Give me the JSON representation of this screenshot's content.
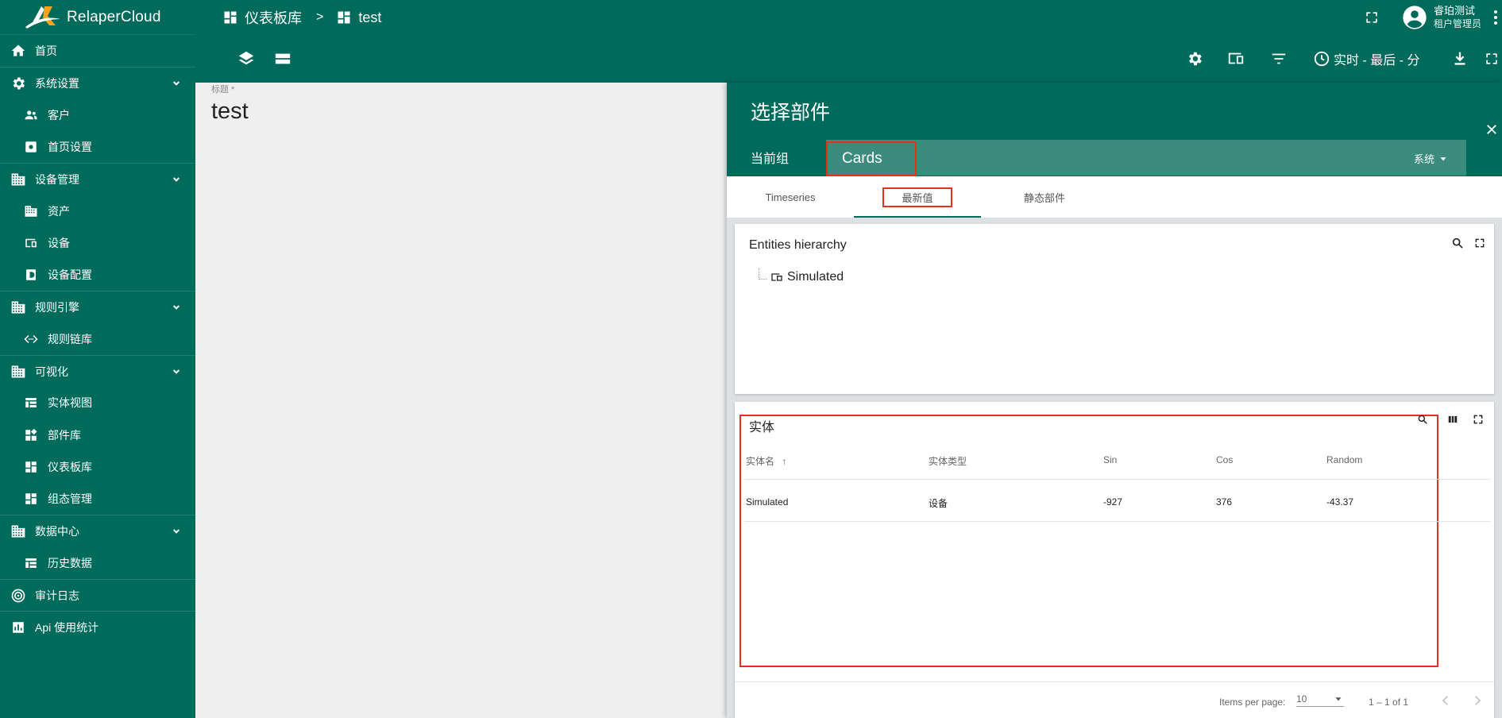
{
  "app": {
    "name": "RelaperCloud"
  },
  "sidebar": {
    "items": [
      {
        "label": "首页",
        "icon": "home-icon",
        "level": "top"
      },
      {
        "label": "系统设置",
        "icon": "gear-icon",
        "level": "top",
        "expandable": true
      },
      {
        "label": "客户",
        "icon": "users-icon",
        "level": "sub"
      },
      {
        "label": "首页设置",
        "icon": "settings-box-icon",
        "level": "sub"
      },
      {
        "label": "设备管理",
        "icon": "building-icon",
        "level": "top",
        "expandable": true
      },
      {
        "label": "资产",
        "icon": "building-icon",
        "level": "sub"
      },
      {
        "label": "设备",
        "icon": "device-icon",
        "level": "sub"
      },
      {
        "label": "设备配置",
        "icon": "profile-icon",
        "level": "sub"
      },
      {
        "label": "规则引擎",
        "icon": "building-icon",
        "level": "top",
        "expandable": true
      },
      {
        "label": "规则链库",
        "icon": "code-icon",
        "level": "sub"
      },
      {
        "label": "可视化",
        "icon": "building-icon",
        "level": "top",
        "expandable": true
      },
      {
        "label": "实体视图",
        "icon": "view-icon",
        "level": "sub"
      },
      {
        "label": "部件库",
        "icon": "widgets-icon",
        "level": "sub"
      },
      {
        "label": "仪表板库",
        "icon": "dashboard-icon",
        "level": "sub"
      },
      {
        "label": "组态管理",
        "icon": "dashboard-icon",
        "level": "sub"
      },
      {
        "label": "数据中心",
        "icon": "building-icon",
        "level": "top",
        "expandable": true
      },
      {
        "label": "历史数据",
        "icon": "view-icon",
        "level": "sub"
      },
      {
        "label": "审计日志",
        "icon": "track-icon",
        "level": "top"
      },
      {
        "label": "Api 使用统计",
        "icon": "chart-icon",
        "level": "top"
      }
    ]
  },
  "breadcrumb": {
    "root": "仪表板库",
    "separator": ">",
    "current": "test"
  },
  "user": {
    "name": "睿珀测试",
    "role": "租户管理员"
  },
  "toolbar": {
    "realtime": "实时 - 最后 - 分"
  },
  "dashboard": {
    "title_label": "标题 *",
    "title_value": "test"
  },
  "panel": {
    "title": "选择部件",
    "group_label": "当前组",
    "group_value": "Cards",
    "group_scope": "系统",
    "tabs": [
      {
        "label": "Timeseries",
        "active": false
      },
      {
        "label": "最新值",
        "active": true
      },
      {
        "label": "静态部件",
        "active": false
      }
    ]
  },
  "hierarchy": {
    "title": "Entities hierarchy",
    "node": "Simulated"
  },
  "entities": {
    "title": "实体",
    "columns": [
      "实体名",
      "实体类型",
      "Sin",
      "Cos",
      "Random"
    ],
    "sort_indicator": "↑",
    "rows": [
      [
        "Simulated",
        "设备",
        "-927",
        "376",
        "-43.37"
      ]
    ]
  },
  "pager": {
    "label": "Items per page:",
    "size": "10",
    "range": "1 – 1 of 1"
  },
  "colors": {
    "primary": "#006a5b",
    "highlight": "#e5321e",
    "group_bg": "#3b8b7f"
  }
}
